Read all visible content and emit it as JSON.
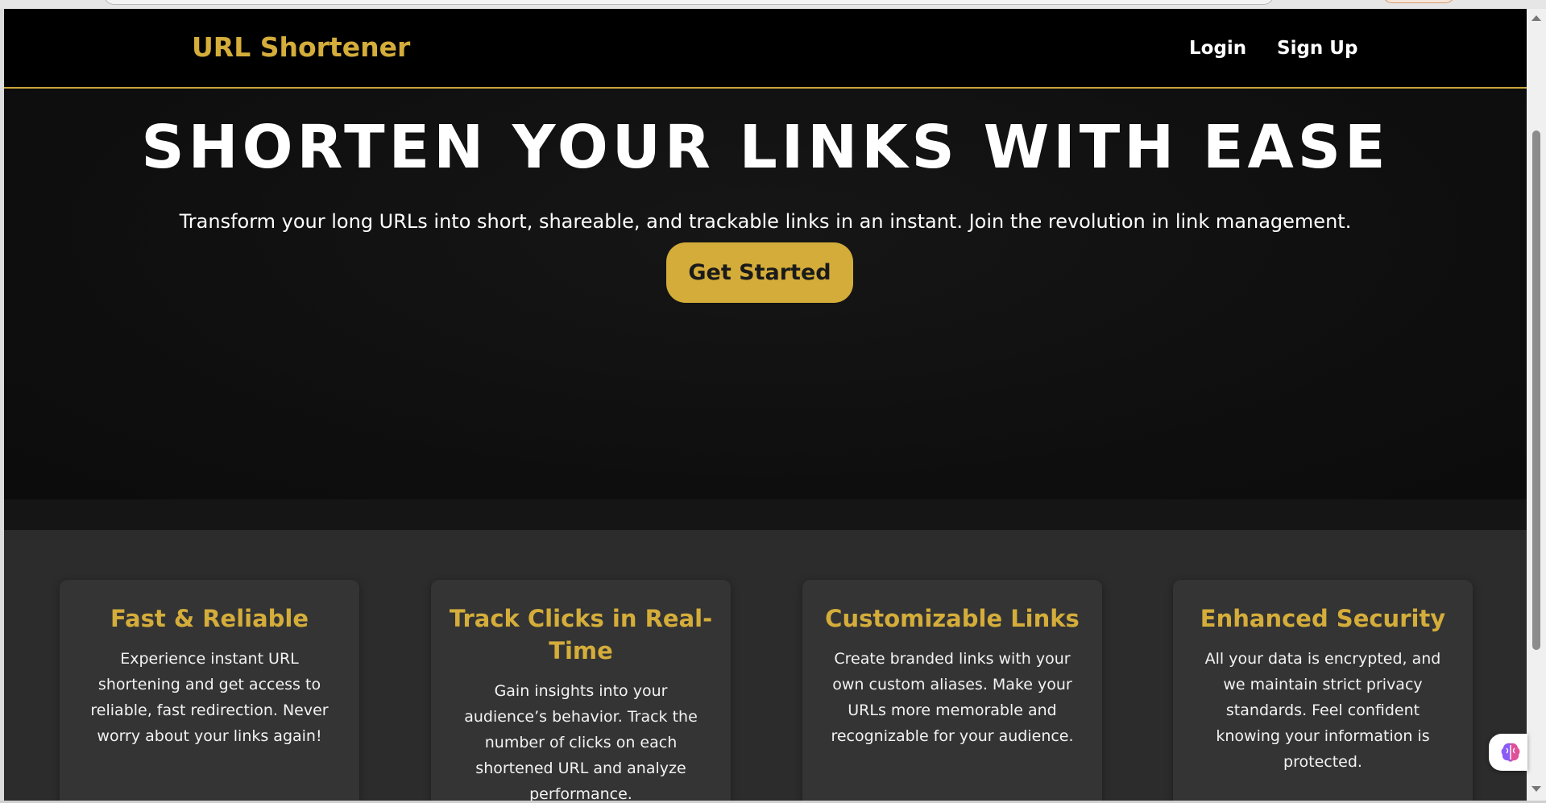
{
  "app": {
    "brand": "URL Shortener",
    "nav": {
      "login": "Login",
      "signup": "Sign Up"
    }
  },
  "hero": {
    "title": "SHORTEN YOUR LINKS WITH EASE",
    "subtitle": "Transform your long URLs into short, shareable, and trackable links in an instant. Join the revolution in link management.",
    "cta_label": "Get Started"
  },
  "features": [
    {
      "title": "Fast & Reliable",
      "text": "Experience instant URL shortening and get access to reliable, fast redirection. Never worry about your links again!"
    },
    {
      "title": "Track Clicks in Real-Time",
      "text": "Gain insights into your audience’s behavior. Track the number of clicks on each shortened URL and analyze performance."
    },
    {
      "title": "Customizable Links",
      "text": "Create branded links with your own custom aliases. Make your URLs more memorable and recognizable for your audience."
    },
    {
      "title": "Enhanced Security",
      "text": "All your data is encrypted, and we maintain strict privacy standards. Feel confident knowing your information is protected."
    }
  ],
  "colors": {
    "accent": "#d4ad3a",
    "navbar_bg": "#000000",
    "hero_bg": "#0f0f0f",
    "features_bg": "#2c2c2c",
    "card_bg": "#343434"
  },
  "icons": {
    "assistant": "brain-icon",
    "scroll_up": "chevron-up-icon",
    "scroll_down": "chevron-down-icon"
  }
}
